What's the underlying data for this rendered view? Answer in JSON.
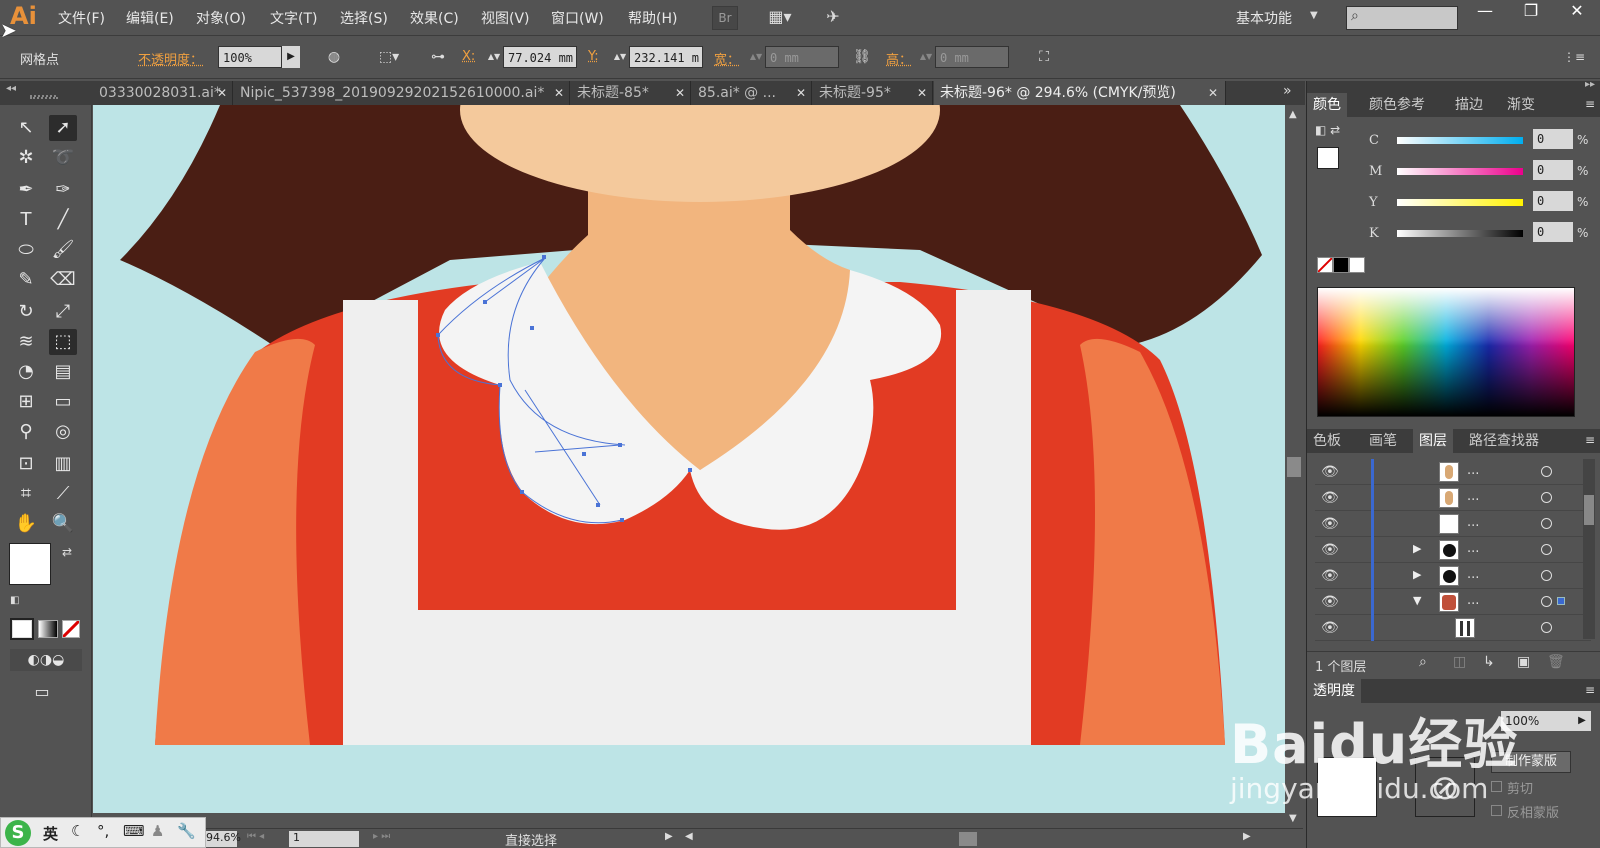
{
  "app": {
    "logo": "Ai"
  },
  "menu": {
    "items": [
      "文件(F)",
      "编辑(E)",
      "对象(O)",
      "文字(T)",
      "选择(S)",
      "效果(C)",
      "视图(V)",
      "窗口(W)",
      "帮助(H)"
    ],
    "bridge_label": "Br",
    "workspace": "基本功能",
    "window_buttons": [
      "—",
      "❐",
      "✕"
    ]
  },
  "control_bar": {
    "object_type": "网格点",
    "opacity_label": "不透明度：",
    "opacity_value": "100%",
    "x_label": "X:",
    "x_value": "77.024 mm",
    "y_label": "Y:",
    "y_value": "232.141 m",
    "width_label": "宽：",
    "width_value": "0 mm",
    "height_label": "高：",
    "height_value": "0 mm"
  },
  "tabs": [
    {
      "label": "03330028031.ai*",
      "active": false
    },
    {
      "label": "Nipic_537398_20190929202152610000.ai*",
      "active": false
    },
    {
      "label": "未标题-85*",
      "active": false
    },
    {
      "label": "85.ai* @ ...",
      "active": false
    },
    {
      "label": "未标题-95*",
      "active": false
    },
    {
      "label": "未标题-96* @ 294.6% (CMYK/预览)",
      "active": true
    }
  ],
  "color_panel": {
    "tabs": [
      "颜色",
      "颜色参考",
      "描边",
      "渐变"
    ],
    "channels": [
      {
        "name": "C",
        "value": "0"
      },
      {
        "name": "M",
        "value": "0"
      },
      {
        "name": "Y",
        "value": "0"
      },
      {
        "name": "K",
        "value": "0"
      }
    ],
    "percent": "%"
  },
  "layers_panel": {
    "tabs": [
      "色板",
      "画笔",
      "图层",
      "路径查找器"
    ],
    "rows": [
      {
        "thumb": "skin",
        "dots": "...",
        "expand": false
      },
      {
        "thumb": "skin",
        "dots": "...",
        "expand": false
      },
      {
        "thumb": "white",
        "dots": "...",
        "expand": false
      },
      {
        "thumb": "eye",
        "dots": "...",
        "expand": true
      },
      {
        "thumb": "eye",
        "dots": "...",
        "expand": true
      },
      {
        "thumb": "face",
        "dots": "...",
        "expand": "open"
      },
      {
        "thumb": "bars",
        "dots": "",
        "expand": false
      }
    ],
    "footer": "1 个图层"
  },
  "transparency_panel": {
    "title": "透明度",
    "opacity_value": "100%",
    "make_mask": "制作蒙版",
    "clip": "剪切",
    "invert_mask": "反相蒙版"
  },
  "status_bar": {
    "zoom": "294.6%",
    "page": "1",
    "tool": "直接选择"
  },
  "watermark": {
    "main": "Baidu经验",
    "sub": "jingyan.baidu.com"
  },
  "ime": {
    "lang": "英"
  },
  "colors": {
    "canvas_bg": "#bde4e6",
    "hair": "#4a1e14",
    "skin": "#f2b57e",
    "dress": "#e23b23",
    "apron": "#efefef",
    "accent": "#e8913a"
  }
}
